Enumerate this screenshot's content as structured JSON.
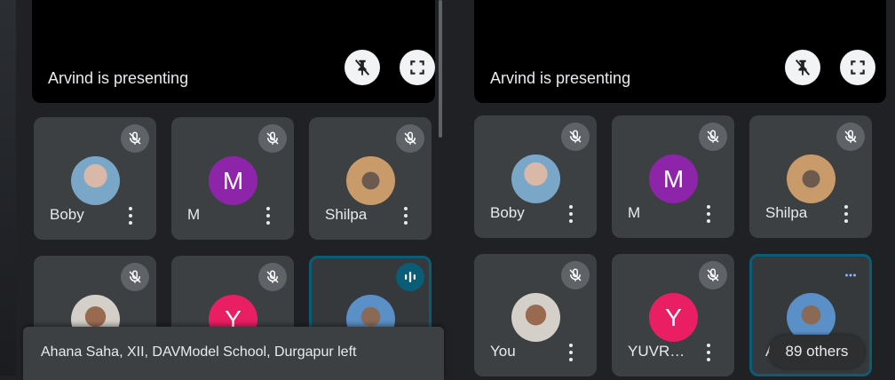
{
  "left_panel": {
    "presenting_label": "Arvind is presenting",
    "tiles": [
      {
        "name": "Boby"
      },
      {
        "name": "M",
        "initial": "M",
        "color": "#8e24aa"
      },
      {
        "name": "Shilpa"
      },
      {
        "name": ""
      },
      {
        "name": "",
        "initial": "Y",
        "color": "#e91e63"
      },
      {
        "name": ""
      }
    ]
  },
  "right_panel": {
    "presenting_label": "Arvind is presenting",
    "tiles": [
      {
        "name": "Boby"
      },
      {
        "name": "M",
        "initial": "M",
        "color": "#8e24aa"
      },
      {
        "name": "Shilpa"
      },
      {
        "name": "You"
      },
      {
        "name": "YUVR…",
        "initial": "Y",
        "color": "#e91e63"
      },
      {
        "name": "Ar"
      }
    ],
    "others_label": "89 others"
  },
  "toast": {
    "text": "Ahana Saha, XII, DAVModel School, Durgapur left"
  },
  "icons": {
    "unpin": "unpin-icon",
    "fullscreen": "fullscreen-icon",
    "mic_off": "mic-off-icon",
    "speaking": "audio-level-icon",
    "more": "more-vert-icon"
  }
}
